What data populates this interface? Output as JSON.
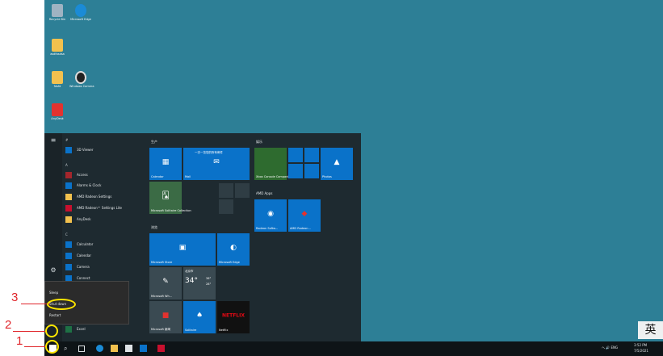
{
  "desktop": {
    "icons": [
      {
        "label": "Recycle Bin",
        "color": "#9fb3c2"
      },
      {
        "label": "Microsoft Edge",
        "color": "#1b8bd6"
      },
      {
        "label": "asdfasdsa",
        "color": "#f2c14e"
      },
      {
        "label": "fdsfd",
        "color": "#f2c14e"
      },
      {
        "label": "Windows Camera",
        "color": "#222222"
      },
      {
        "label": "AnyDesk",
        "color": "#e2322f"
      }
    ]
  },
  "start": {
    "applist": [
      {
        "kind": "letter",
        "text": "#"
      },
      {
        "kind": "app",
        "text": "3D Viewer",
        "color": "#0a72c9"
      },
      {
        "kind": "letter",
        "text": "A"
      },
      {
        "kind": "app",
        "text": "Access",
        "color": "#a4262c"
      },
      {
        "kind": "app",
        "text": "Alarms & Clock",
        "color": "#0a72c9"
      },
      {
        "kind": "app",
        "text": "AMD Radeon Settings",
        "color": "#f2c14e"
      },
      {
        "kind": "app",
        "text": "AMD Radeon™ Settings Lite",
        "color": "#c8102e"
      },
      {
        "kind": "app",
        "text": "AnyDesk",
        "color": "#f2c14e"
      },
      {
        "kind": "letter",
        "text": "C"
      },
      {
        "kind": "app",
        "text": "Calculator",
        "color": "#0a72c9"
      },
      {
        "kind": "app",
        "text": "Calendar",
        "color": "#0a72c9"
      },
      {
        "kind": "app",
        "text": "Camera",
        "color": "#0a72c9"
      },
      {
        "kind": "app",
        "text": "Connect",
        "color": "#0a72c9"
      }
    ],
    "bottom_app": {
      "text": "Excel",
      "color": "#1e7145"
    },
    "power_menu": [
      "Sleep",
      "Shut down",
      "Restart"
    ],
    "groups": {
      "g1": "生产",
      "g2": "娱乐",
      "g3": "浏览",
      "g4": "AMD Apps"
    },
    "tiles": {
      "calendar": "Calendar",
      "mail": "Mail",
      "mail_banner": "一次一览您的所有邮件",
      "solitaire": "Microsoft Solitaire Collection",
      "xbox": "Xbox Console Companion",
      "photos": "Photos",
      "radeon": "Radeon Softw...",
      "amd_link": "AMD Radeon...",
      "store": "Microsoft Store",
      "edge": "Microsoft Edge",
      "whiteboard": "Microsoft Wh...",
      "weather_city": "北京市",
      "weather_temp": "34°",
      "weather_hi": "36°",
      "weather_lo": "28°",
      "news": "Microsoft 新闻",
      "netflix_logo": "NETFLIX",
      "netflix": "Netflix",
      "solitaire2": "Solitaire"
    }
  },
  "taskbar": {
    "tray_text": "へ 🔊 ENG",
    "time": "3:52 PM",
    "date": "7/5/2021"
  },
  "ime": "英",
  "callouts": [
    "3",
    "2",
    "1"
  ]
}
